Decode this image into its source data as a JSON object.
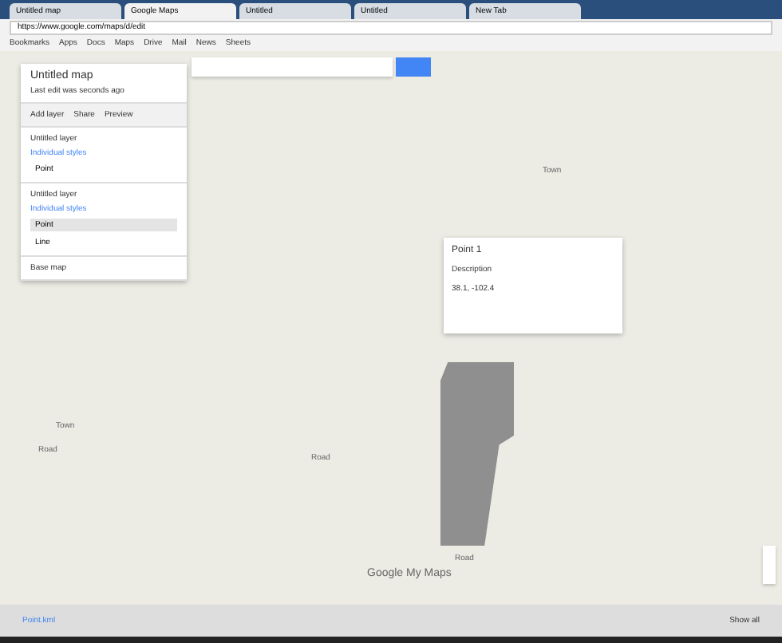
{
  "tabs": [
    {
      "label": "Untitled map",
      "selected": false
    },
    {
      "label": "Google Maps",
      "selected": true
    },
    {
      "label": "Untitled",
      "selected": false
    },
    {
      "label": "Untitled",
      "selected": false
    },
    {
      "label": "New Tab",
      "selected": false
    }
  ],
  "address": {
    "value": "https://www.google.com/maps/d/edit"
  },
  "bookmarks": [
    "Bookmarks",
    "Apps",
    "Docs",
    "Maps",
    "Drive",
    "Mail",
    "News",
    "Sheets"
  ],
  "panel": {
    "title": "Untitled map",
    "subtitle": "Last edit was seconds ago",
    "actions": [
      "Add layer",
      "Share",
      "Preview"
    ],
    "layers": [
      {
        "name": "Untitled layer",
        "style": "Individual styles",
        "items": [
          {
            "label": "Point",
            "selected": false
          }
        ]
      },
      {
        "name": "Untitled layer",
        "style": "Individual styles",
        "items": [
          {
            "label": "Point",
            "selected": true
          },
          {
            "label": "Line",
            "selected": false
          }
        ]
      }
    ],
    "base_map": "Base map"
  },
  "popup": {
    "title": "Point 1",
    "text": "Description",
    "coords": "38.1, -102.4"
  },
  "map_labels": [
    "Town",
    "Road",
    "Road",
    "Town",
    "Road"
  ],
  "logo": "Google My Maps",
  "download": {
    "file": "Point.kml",
    "show_all": "Show all"
  }
}
